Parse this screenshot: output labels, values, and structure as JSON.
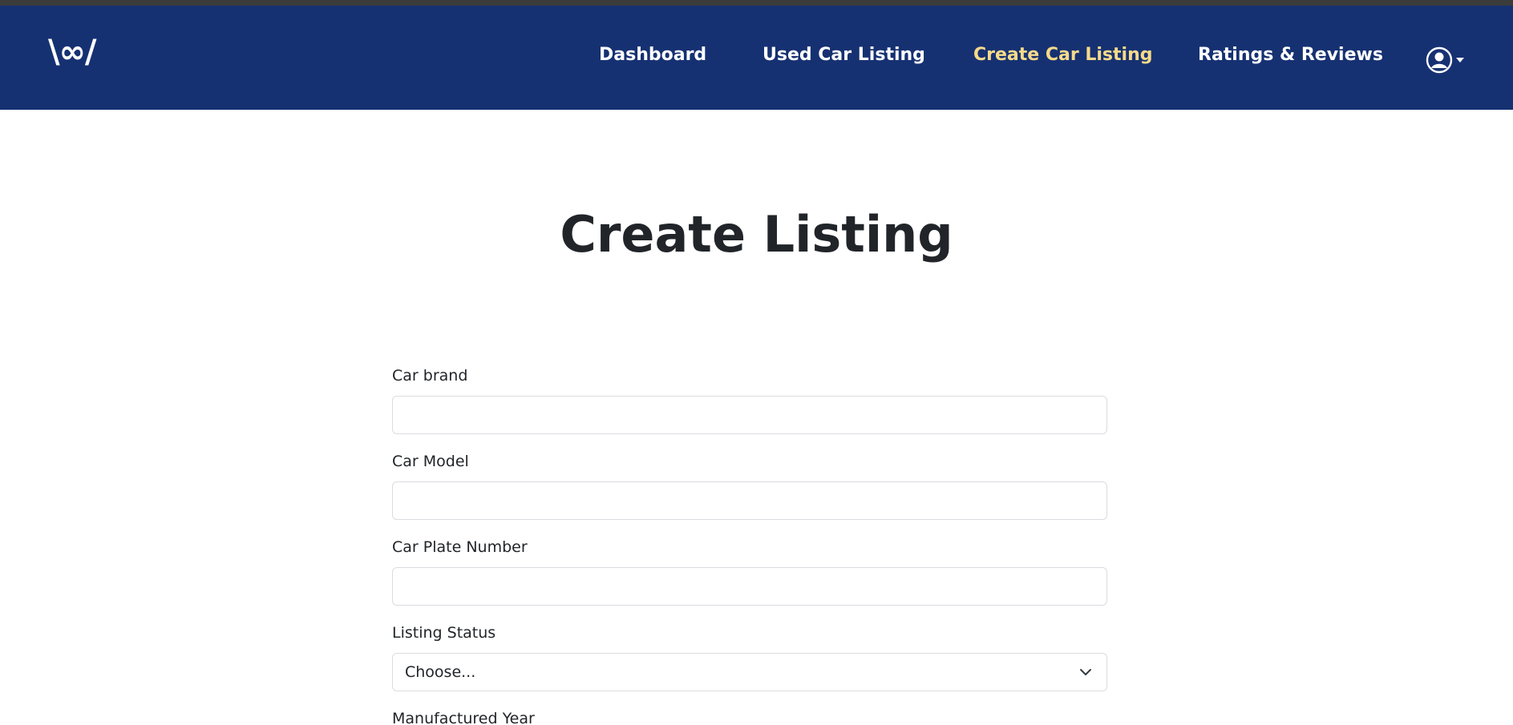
{
  "nav": {
    "logo": "\\∞/",
    "links": [
      {
        "label": "Dashboard"
      },
      {
        "label": "Used Car Listing"
      },
      {
        "label": "Create Car Listing"
      },
      {
        "label": "Ratings & Reviews"
      }
    ],
    "active_color": "#f6da8a",
    "background": "#163172",
    "profile_icon": "user-circle-icon"
  },
  "page": {
    "title": "Create Listing"
  },
  "form": {
    "car_brand": {
      "label": "Car brand",
      "value": ""
    },
    "car_model": {
      "label": "Car Model",
      "value": ""
    },
    "car_plate": {
      "label": "Car Plate Number",
      "value": ""
    },
    "listing_status": {
      "label": "Listing Status",
      "selected": "Choose..."
    },
    "manufactured_year": {
      "label": "Manufactured Year"
    }
  }
}
